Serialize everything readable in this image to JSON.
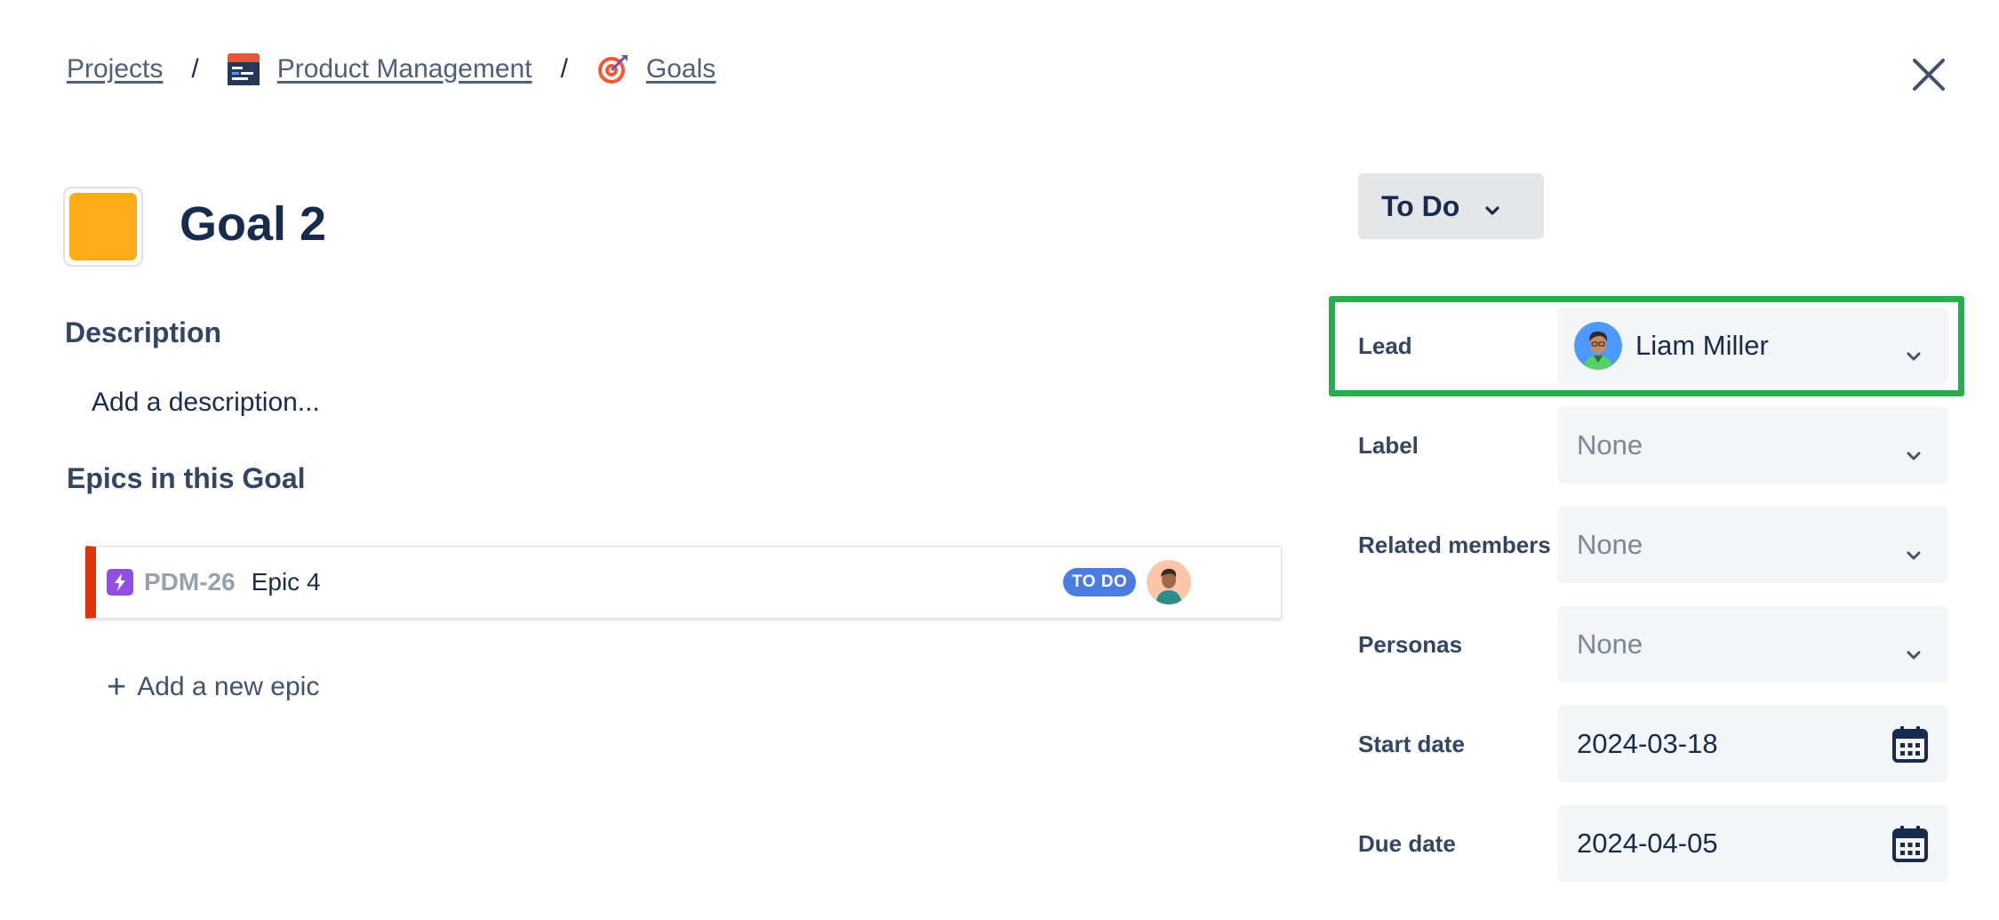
{
  "breadcrumb": {
    "projects": "Projects",
    "separator": "/",
    "project": "Product Management",
    "section": "Goals"
  },
  "icons": {
    "close": "close-icon",
    "project": "project-board-icon",
    "goals": "target-icon",
    "epic": "lightning-icon",
    "chevron": "chevron-down-icon",
    "calendar": "calendar-icon"
  },
  "goal": {
    "title": "Goal 2",
    "color": "#fcad17"
  },
  "description": {
    "heading": "Description",
    "placeholder": "Add a description..."
  },
  "epics": {
    "heading": "Epics in this Goal",
    "items": [
      {
        "key": "PDM-26",
        "name": "Epic 4",
        "status": "TO DO"
      }
    ],
    "add_label": "Add a new epic"
  },
  "status": {
    "label": "To Do"
  },
  "fields": {
    "lead": {
      "label": "Lead",
      "value": "Liam Miller"
    },
    "label": {
      "label": "Label",
      "value": "None"
    },
    "related_members": {
      "label": "Related members",
      "value": "None"
    },
    "personas": {
      "label": "Personas",
      "value": "None"
    },
    "start_date": {
      "label": "Start date",
      "value": "2024-03-18"
    },
    "due_date": {
      "label": "Due date",
      "value": "2024-04-05"
    }
  },
  "colors": {
    "highlight": "#22b14c",
    "epic_accent": "#de350b",
    "status_badge": "#4a7de1"
  }
}
